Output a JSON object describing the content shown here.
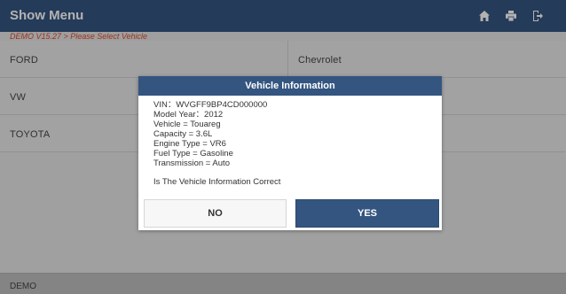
{
  "header": {
    "title": "Show Menu",
    "home_icon": "home-icon",
    "print_icon": "print-icon",
    "exit_icon": "exit-icon"
  },
  "breadcrumb": "DEMO V15.27 > Please Select  Vehicle",
  "grid": {
    "items": [
      "FORD",
      "Chevrolet",
      "VW",
      "",
      "TOYOTA",
      ""
    ]
  },
  "footer": {
    "label": "DEMO"
  },
  "dialog": {
    "title": "Vehicle Information",
    "lines": [
      "VIN：WVGFF9BP4CD000000",
      "Model Year：2012",
      "Vehicle = Touareg",
      "Capacity = 3.6L",
      "Engine Type = VR6",
      "Fuel Type = Gasoline",
      "Transmission = Auto"
    ],
    "question": "Is The Vehicle Information Correct",
    "no_label": "NO",
    "yes_label": "YES"
  },
  "colors": {
    "header_bg": "#345580",
    "breadcrumb_text": "#e0482a",
    "yes_button_bg": "#345580"
  }
}
